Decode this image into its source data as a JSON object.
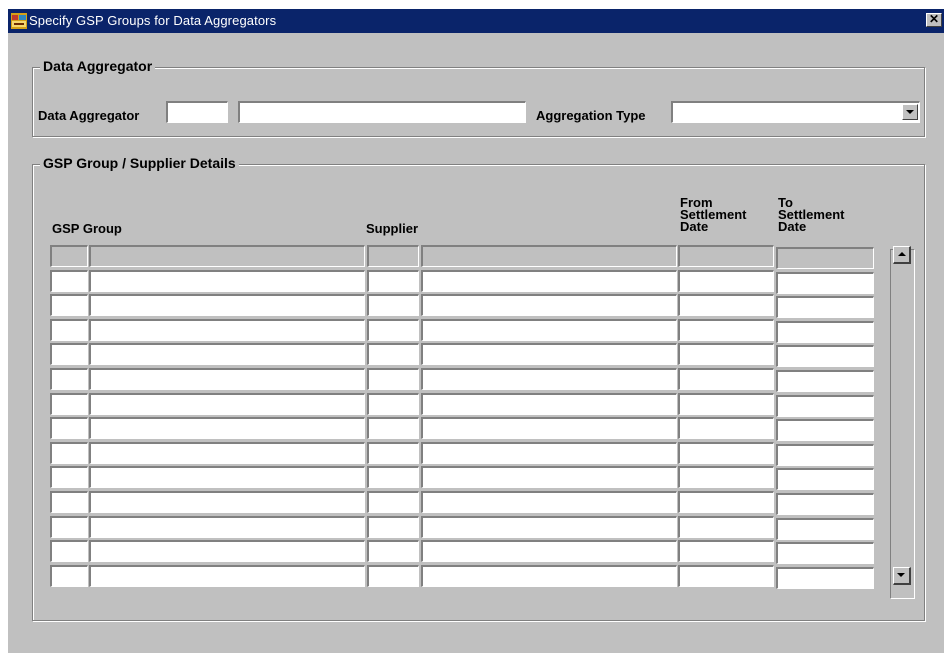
{
  "window": {
    "title": "Specify GSP Groups for Data Aggregators",
    "close_symbol": "✕"
  },
  "data_aggregator_section": {
    "title": "Data Aggregator",
    "data_aggregator_label": "Data Aggregator",
    "data_aggregator_id_value": "",
    "data_aggregator_name_value": "",
    "aggregation_type_label": "Aggregation Type",
    "aggregation_type_value": ""
  },
  "details_section": {
    "title": "GSP Group / Supplier Details",
    "columns": {
      "gsp_group": "GSP Group",
      "supplier": "Supplier",
      "from_settlement_date": "From\nSettlement\nDate",
      "to_settlement_date": "To\nSettlement\nDate"
    },
    "rows": [
      {
        "gsp_id": "",
        "gsp_name": "",
        "supplier_id": "",
        "supplier_name": "",
        "from_date": "",
        "to_date": ""
      },
      {
        "gsp_id": "",
        "gsp_name": "",
        "supplier_id": "",
        "supplier_name": "",
        "from_date": "",
        "to_date": ""
      },
      {
        "gsp_id": "",
        "gsp_name": "",
        "supplier_id": "",
        "supplier_name": "",
        "from_date": "",
        "to_date": ""
      },
      {
        "gsp_id": "",
        "gsp_name": "",
        "supplier_id": "",
        "supplier_name": "",
        "from_date": "",
        "to_date": ""
      },
      {
        "gsp_id": "",
        "gsp_name": "",
        "supplier_id": "",
        "supplier_name": "",
        "from_date": "",
        "to_date": ""
      },
      {
        "gsp_id": "",
        "gsp_name": "",
        "supplier_id": "",
        "supplier_name": "",
        "from_date": "",
        "to_date": ""
      },
      {
        "gsp_id": "",
        "gsp_name": "",
        "supplier_id": "",
        "supplier_name": "",
        "from_date": "",
        "to_date": ""
      },
      {
        "gsp_id": "",
        "gsp_name": "",
        "supplier_id": "",
        "supplier_name": "",
        "from_date": "",
        "to_date": ""
      },
      {
        "gsp_id": "",
        "gsp_name": "",
        "supplier_id": "",
        "supplier_name": "",
        "from_date": "",
        "to_date": ""
      },
      {
        "gsp_id": "",
        "gsp_name": "",
        "supplier_id": "",
        "supplier_name": "",
        "from_date": "",
        "to_date": ""
      },
      {
        "gsp_id": "",
        "gsp_name": "",
        "supplier_id": "",
        "supplier_name": "",
        "from_date": "",
        "to_date": ""
      },
      {
        "gsp_id": "",
        "gsp_name": "",
        "supplier_id": "",
        "supplier_name": "",
        "from_date": "",
        "to_date": ""
      },
      {
        "gsp_id": "",
        "gsp_name": "",
        "supplier_id": "",
        "supplier_name": "",
        "from_date": "",
        "to_date": ""
      },
      {
        "gsp_id": "",
        "gsp_name": "",
        "supplier_id": "",
        "supplier_name": "",
        "from_date": "",
        "to_date": ""
      }
    ]
  },
  "icons": {
    "app": "forms-app-icon",
    "close": "close-icon",
    "dropdown": "chevron-down-icon",
    "scroll_up": "arrow-up-icon",
    "scroll_down": "arrow-down-icon"
  },
  "colors": {
    "titlebar": "#0a246a",
    "window_bg": "#c0c0c0",
    "field_bg": "#ffffff"
  }
}
